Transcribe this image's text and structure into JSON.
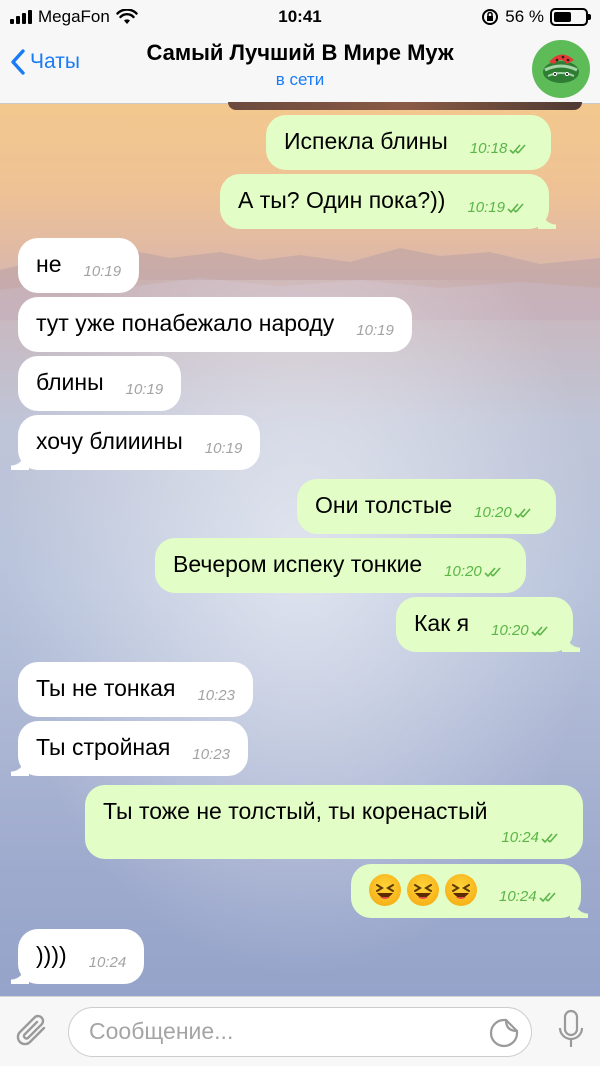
{
  "status_bar": {
    "carrier": "MegaFon",
    "time": "10:41",
    "battery": "56 %",
    "battery_level": 0.56
  },
  "header": {
    "back_label": "Чаты",
    "title": "Самый Лучший В Мире Муж",
    "subtitle": "в сети",
    "accent_color": "#1a7cf5"
  },
  "messages": [
    {
      "dir": "out",
      "text": "Испекла блины",
      "time": "10:18"
    },
    {
      "dir": "out",
      "text": "А ты? Один пока?))",
      "time": "10:19"
    },
    {
      "dir": "in",
      "text": "не",
      "time": "10:19"
    },
    {
      "dir": "in",
      "text": "тут уже понабежало народу",
      "time": "10:19"
    },
    {
      "dir": "in",
      "text": "блины",
      "time": "10:19"
    },
    {
      "dir": "in",
      "text": "хочу блииины",
      "time": "10:19"
    },
    {
      "dir": "out",
      "text": "Они толстые",
      "time": "10:20"
    },
    {
      "dir": "out",
      "text": "Вечером испеку тонкие",
      "time": "10:20"
    },
    {
      "dir": "out",
      "text": "Как я",
      "time": "10:20"
    },
    {
      "dir": "in",
      "text": "Ты не тонкая",
      "time": "10:23"
    },
    {
      "dir": "in",
      "text": "Ты стройная",
      "time": "10:23"
    },
    {
      "dir": "out",
      "text": "Ты тоже не толстый, ты коренастый",
      "time": "10:24"
    },
    {
      "dir": "out",
      "text": "😆😆😆",
      "time": "10:24",
      "emoji": "laughing-face x3"
    },
    {
      "dir": "in",
      "text": "))))",
      "time": "10:24"
    }
  ],
  "input": {
    "placeholder": "Сообщение..."
  },
  "icons": {
    "back": "chevron-left-icon",
    "attach": "paperclip-icon",
    "sticker": "sticker-icon",
    "mic": "microphone-icon",
    "read": "double-check-icon"
  },
  "colors": {
    "incoming_bubble": "#ffffff",
    "outgoing_bubble": "#e2fdc6",
    "outgoing_time": "#5bb548"
  }
}
